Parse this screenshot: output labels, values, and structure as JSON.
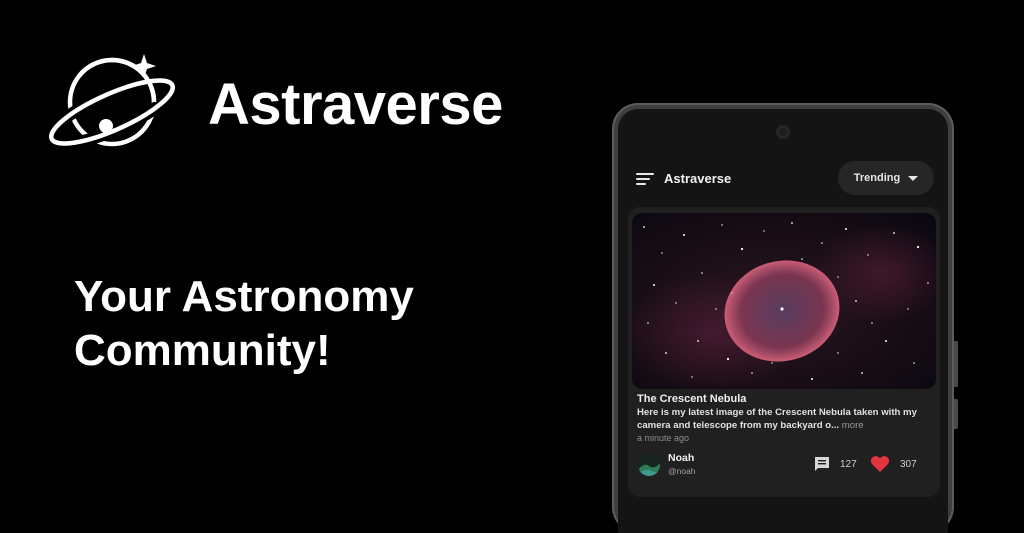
{
  "promo": {
    "brand_name": "Astraverse",
    "tagline_line1": "Your Astronomy",
    "tagline_line2": "Community!"
  },
  "app": {
    "title": "Astraverse",
    "sort_label": "Trending"
  },
  "post": {
    "title": "The Crescent Nebula",
    "body": "Here is my latest image of the Crescent Nebula taken with my camera and telescope from my backyard o...",
    "more_label": "more",
    "timestamp": "a minute ago",
    "author_name": "Noah",
    "author_handle": "@noah",
    "comment_count": "127",
    "like_count": "307"
  },
  "colors": {
    "background": "#000000",
    "screen": "#141414",
    "card": "#202020",
    "like_red": "#e0353f",
    "nebula": "#c2566e"
  },
  "icons": [
    "planet-logo-icon",
    "sparkle-icon",
    "menu-icon",
    "caret-down-icon",
    "comment-icon",
    "heart-icon"
  ]
}
